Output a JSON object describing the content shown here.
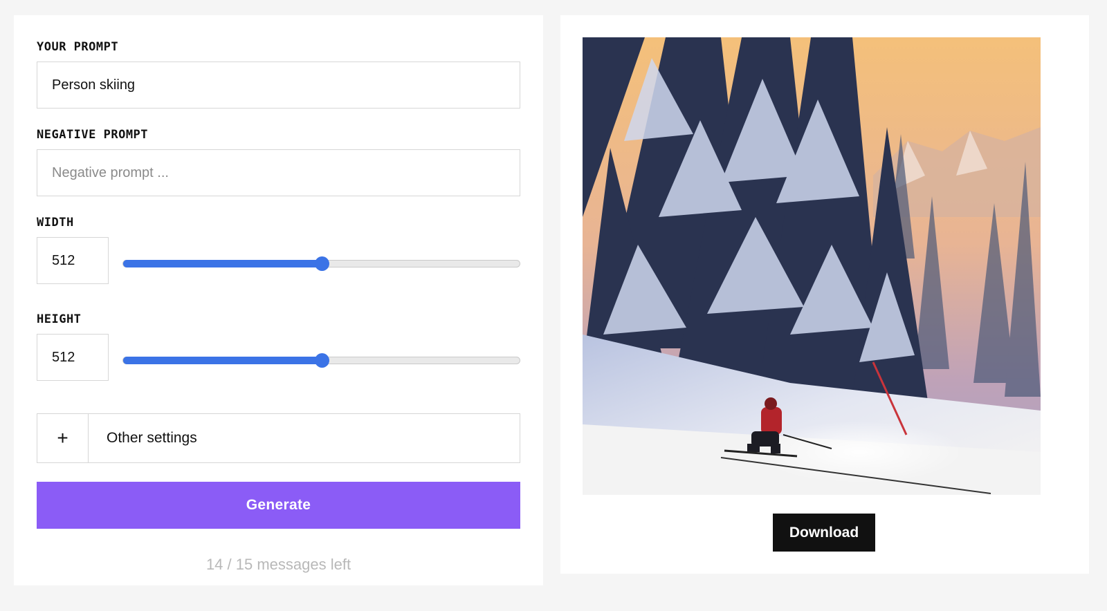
{
  "prompt": {
    "label": "YOUR PROMPT",
    "value": "Person skiing"
  },
  "negative_prompt": {
    "label": "NEGATIVE PROMPT",
    "value": "",
    "placeholder": "Negative prompt ..."
  },
  "width": {
    "label": "WIDTH",
    "value": "512",
    "slider_fraction": 0.5
  },
  "height": {
    "label": "HEIGHT",
    "value": "512",
    "slider_fraction": 0.5
  },
  "other_settings": {
    "toggle_symbol": "+",
    "label": "Other settings"
  },
  "generate_label": "Generate",
  "messages_left": "14 / 15 messages left",
  "download_label": "Download",
  "colors": {
    "accent_purple": "#8b5cf6",
    "slider_blue": "#3b73e6",
    "download_black": "#111111"
  }
}
